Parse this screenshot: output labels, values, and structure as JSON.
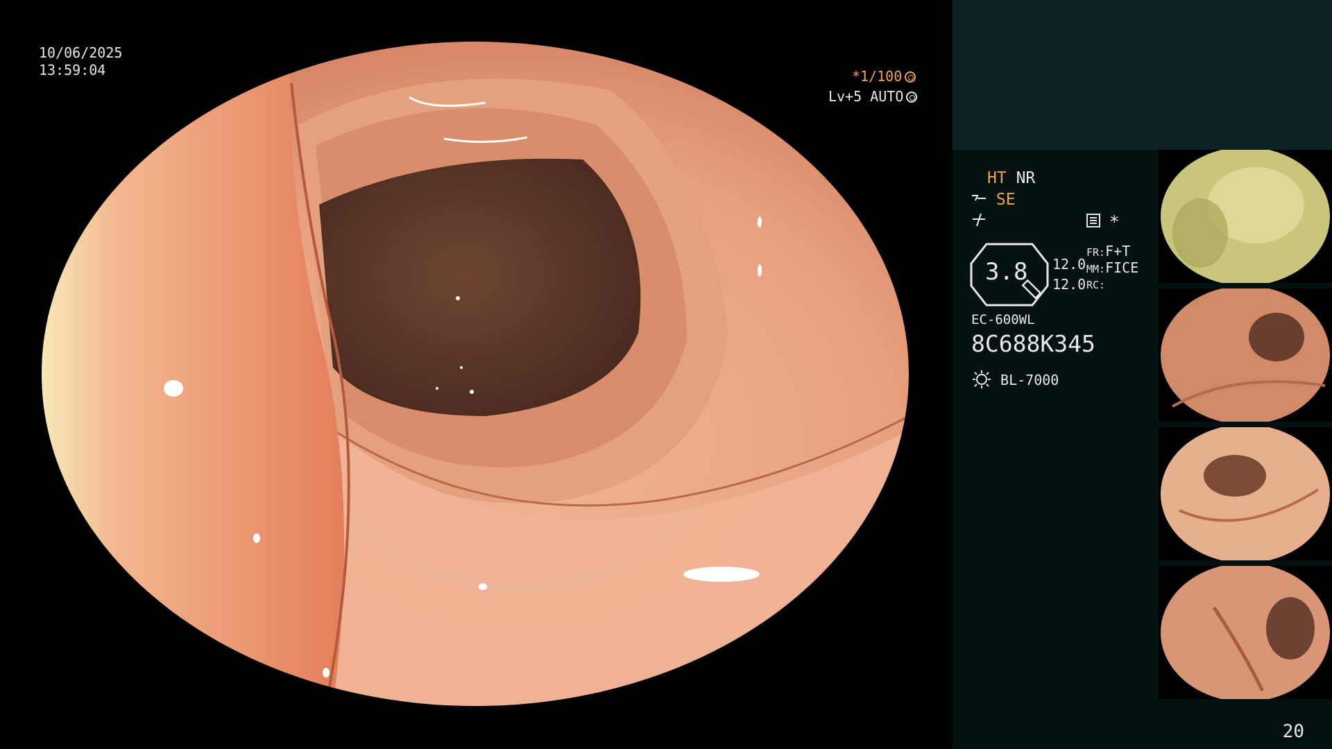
{
  "overlay": {
    "date": "10/06/2025",
    "time": "13:59:04",
    "shutter": "*1/100",
    "level": "Lv+5 AUTO"
  },
  "panel": {
    "ht": "HT",
    "nr": "NR",
    "se": "SE",
    "ratio": "3.8",
    "val1": "12.0",
    "val2": "12.0",
    "fr_label": "FR:",
    "fr_value": "F+T",
    "mm_label": "MM:",
    "mm_value": "FICE",
    "rc_label": "RC:",
    "scope_model": "EC-600WL",
    "serial": "8C688K345",
    "light_source": "BL-7000",
    "asterisk": "*"
  },
  "page_number": "20",
  "colors": {
    "accent": "#f2a640",
    "panel_bg": "#061211",
    "top_strip": "#0d2324"
  }
}
